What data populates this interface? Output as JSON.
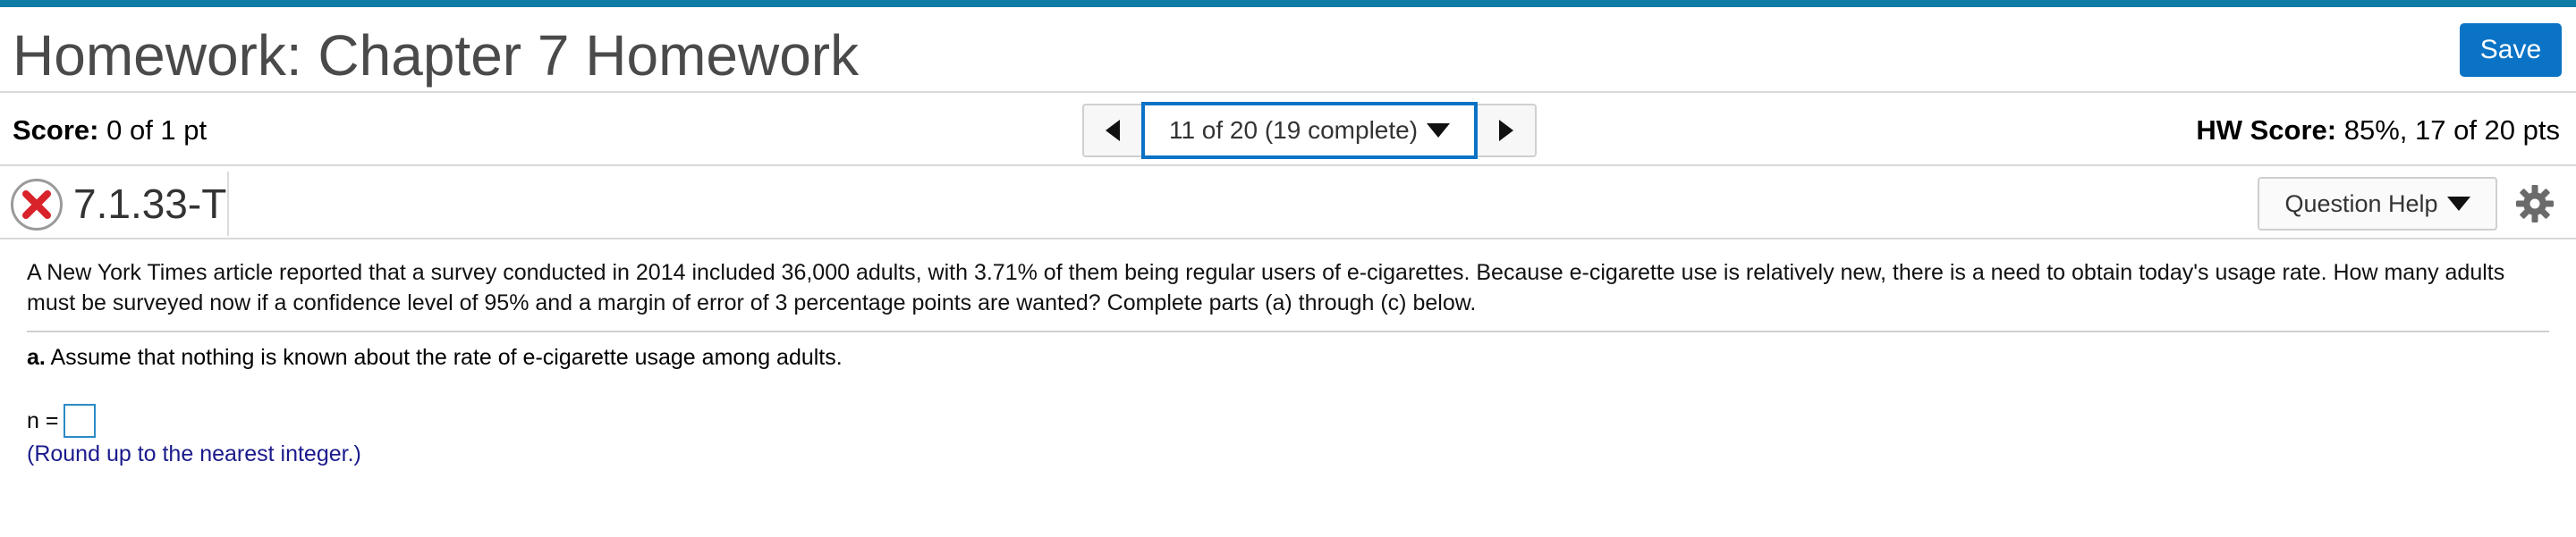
{
  "header": {
    "title": "Homework: Chapter 7 Homework",
    "save_label": "Save"
  },
  "scorebar": {
    "score_label": "Score:",
    "score_value": "0 of 1 pt",
    "navigator_text": "11 of 20 (19 complete)",
    "hw_score_label": "HW Score:",
    "hw_score_value": "85%, 17 of 20 pts"
  },
  "question": {
    "id": "7.1.33-T",
    "status_icon": "incorrect-x-icon",
    "help_label": "Question Help",
    "settings_icon": "gear-icon"
  },
  "problem": {
    "text": "A New York Times article reported that a survey conducted in 2014 included 36,000 adults, with 3.71% of them being regular users of e-cigarettes. Because e-cigarette use is relatively new, there is a need to obtain today's usage rate. How many adults must be surveyed now if a confidence level of 95% and a margin of error of 3 percentage points are wanted? Complete parts (a) through (c) below.",
    "part_a_label": "a.",
    "part_a_text": "Assume that nothing is known about the rate of e-cigarette usage among adults.",
    "answer_label": "n =",
    "answer_value": "",
    "hint": "(Round up to the nearest integer.)"
  },
  "colors": {
    "accent": "#0a73c5",
    "topbar": "#0f7ca6",
    "hint": "#1a1a8c",
    "incorrect": "#d9232a"
  }
}
